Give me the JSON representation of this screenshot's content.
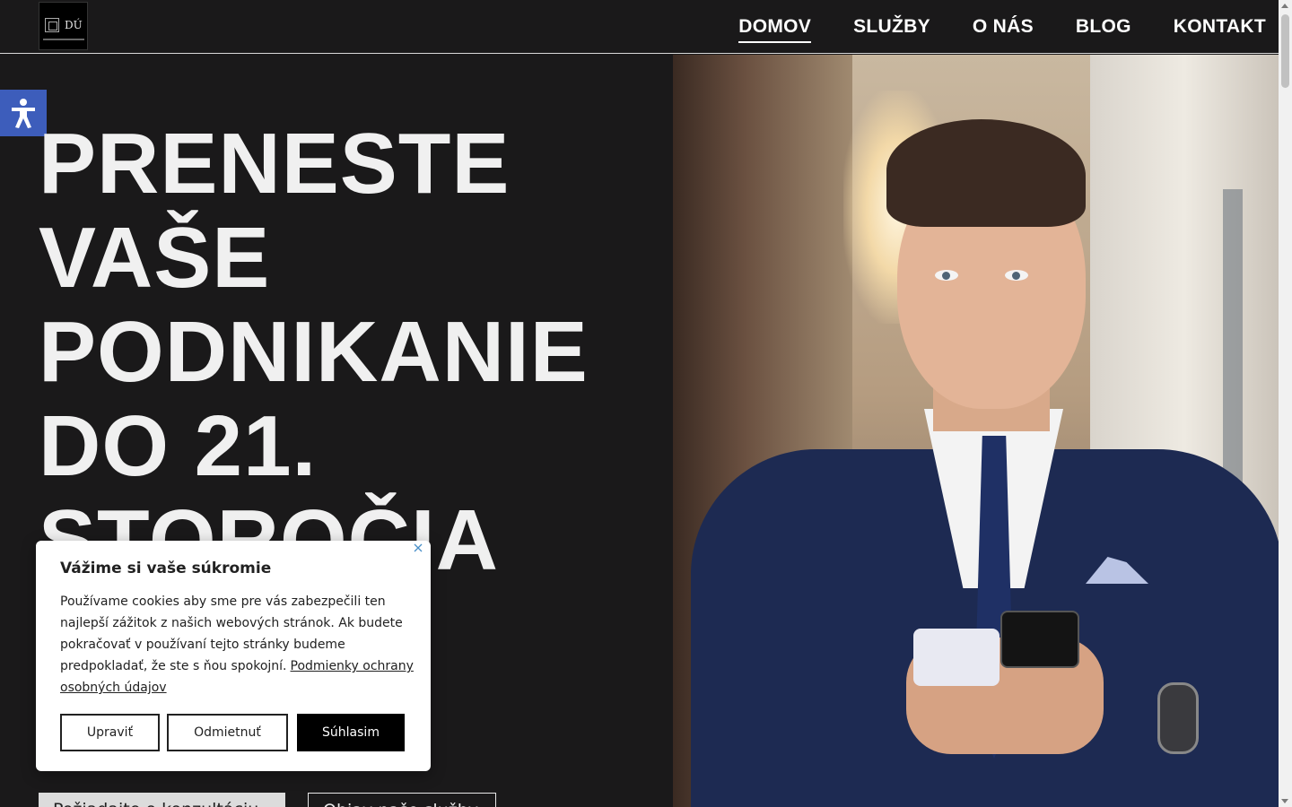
{
  "header": {
    "logo": {
      "monogram": "DÚ",
      "alt": "logo"
    },
    "nav": [
      {
        "label": "DOMOV",
        "active": true
      },
      {
        "label": "SLUŽBY",
        "active": false
      },
      {
        "label": "O NÁS",
        "active": false
      },
      {
        "label": "BLOG",
        "active": false
      },
      {
        "label": "KONTAKT",
        "active": false
      }
    ]
  },
  "accessibility": {
    "icon": "accessibility-icon",
    "color": "#3d5dbb"
  },
  "hero": {
    "title_lines": [
      "PRENESTE",
      "VAŠE",
      "PODNIKANIE",
      "DO 21.",
      "STOROČIA"
    ],
    "buttons": {
      "primary": "Požiadajte o konzultáciu",
      "secondary": "Objav naše služby"
    }
  },
  "cookie": {
    "title": "Vážime si vaše súkromie",
    "text": "Používame cookies aby sme pre vás zabezpečili ten najlepší zážitok z našich webových stránok. Ak budete pokračovať v používaní tejto stránky budeme predpokladať, že ste s ňou spokojní.",
    "link": "Podmienky ochrany osobných údajov",
    "buttons": {
      "customize": "Upraviť",
      "reject": "Odmietnuť",
      "accept": "Súhlasim"
    }
  },
  "colors": {
    "background": "#1a191a",
    "text": "#f0f0f0",
    "accent": "#3d5dbb"
  }
}
